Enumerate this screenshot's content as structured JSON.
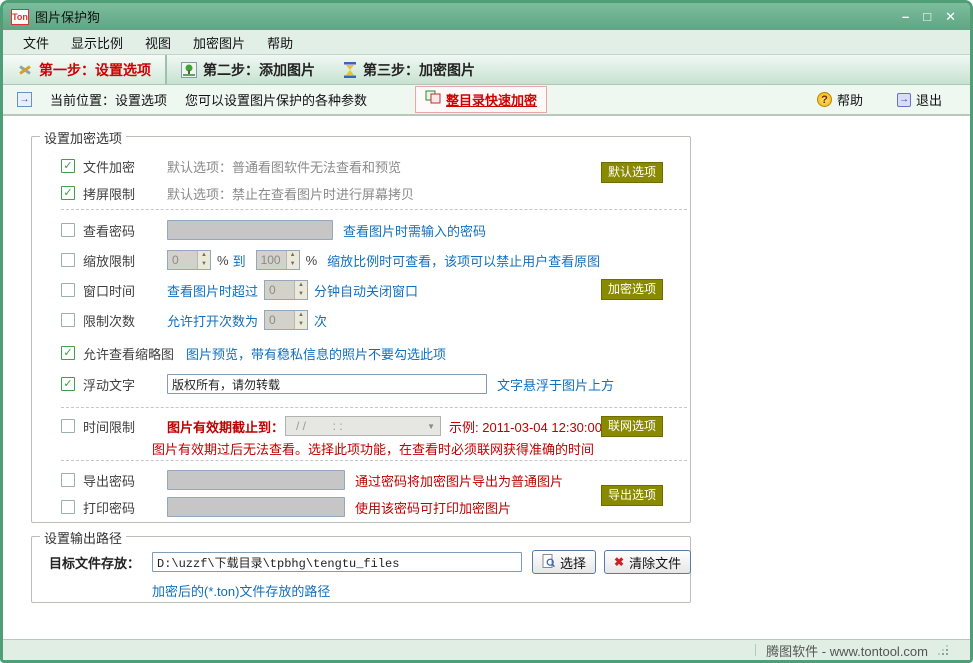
{
  "window": {
    "logo": "Ton",
    "title": "图片保护狗",
    "minimize": "–",
    "maximize": "□",
    "close": "✕"
  },
  "menu": {
    "items": [
      "文件",
      "显示比例",
      "视图",
      "加密图片",
      "帮助"
    ]
  },
  "steps": [
    {
      "label": "第一步：设置选项"
    },
    {
      "label": "第二步：添加图片"
    },
    {
      "label": "第三步：加密图片"
    }
  ],
  "navbar": {
    "location": "当前位置：设置选项",
    "hint": "您可以设置图片保护的各种参数",
    "quick_encrypt": "整目录快速加密",
    "help": "帮助",
    "exit": "退出"
  },
  "icons": {
    "check": "✓",
    "up": "▲",
    "down": "▼",
    "dropdown": "▼",
    "question": "?",
    "exit_arrow": "→",
    "clear_x": "✖",
    "nav_arrow": "→"
  },
  "enc": {
    "title": "设置加密选项",
    "buttons": {
      "default": "默认选项",
      "encrypt": "加密选项",
      "network": "联网选项",
      "export": "导出选项"
    },
    "file_encrypt": {
      "label": "文件加密",
      "desc": "默认选项：普通看图软件无法查看和预览"
    },
    "screen_copy": {
      "label": "拷屏限制",
      "desc": "默认选项：禁止在查看图片时进行屏幕拷贝"
    },
    "view_password": {
      "label": "查看密码",
      "desc": "查看图片时需输入的密码"
    },
    "zoom_limit": {
      "label": "缩放限制",
      "from": "0",
      "pct1": "%",
      "word_to": "到",
      "to": "100",
      "pct2": "%",
      "desc": "缩放比例时可查看，该项可以禁止用户查看原图"
    },
    "window_time": {
      "label": "窗口时间",
      "pre": "查看图片时超过",
      "value": "0",
      "post": "分钟自动关闭窗口"
    },
    "open_times": {
      "label": "限制次数",
      "pre": "允许打开次数为",
      "value": "0",
      "post": "次"
    },
    "thumbnail": {
      "label": "允许查看缩略图",
      "desc": "图片预览，带有稳私信息的照片不要勾选此项"
    },
    "float_text": {
      "label": "浮动文字",
      "value": "版权所有，请勿转载",
      "desc": "文字悬浮于图片上方"
    },
    "time_limit": {
      "label": "时间限制",
      "pre": "图片有效期截止到：",
      "combo": "/ /        : :",
      "example": "示例: 2011-03-04 12:30:00",
      "note": "图片有效期过后无法查看。选择此项功能，在查看时必须联网获得准确的时间"
    },
    "export_password": {
      "label": "导出密码",
      "desc": "通过密码将加密图片导出为普通图片"
    },
    "print_password": {
      "label": "打印密码",
      "desc": "使用该密码可打印加密图片"
    }
  },
  "output": {
    "title": "设置输出路径",
    "target_label": "目标文件存放：",
    "path": "D:\\uzzf\\下载目录\\tpbhg\\tengtu_files",
    "browse": "选择",
    "clear": "清除文件",
    "note": "加密后的(*.ton)文件存放的路径"
  },
  "status": {
    "text": "腾图软件 - www.tontool.com"
  },
  "colors": {
    "titlebar": "#6bb08e",
    "olive_button": "#8a8a00",
    "link_blue": "#1070c0",
    "warn_red": "#c00000"
  }
}
